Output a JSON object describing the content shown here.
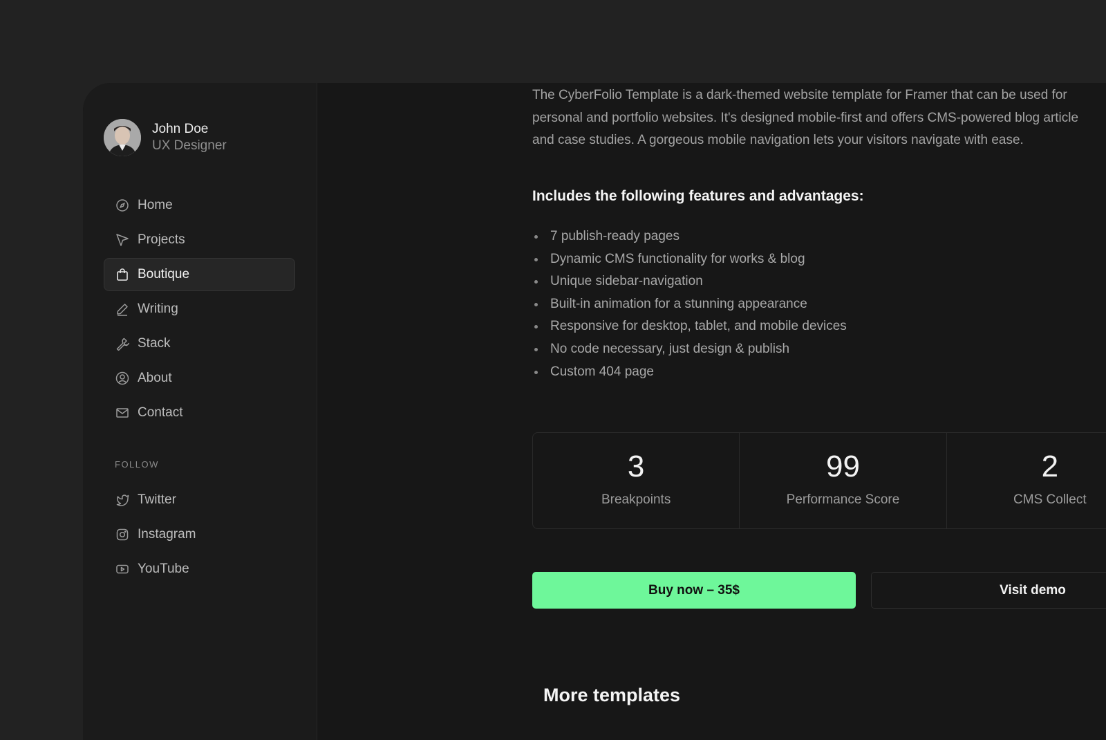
{
  "profile": {
    "name": "John Doe",
    "role": "UX Designer"
  },
  "nav": {
    "items": [
      {
        "label": "Home",
        "icon": "compass-icon",
        "active": false
      },
      {
        "label": "Projects",
        "icon": "send-icon",
        "active": false
      },
      {
        "label": "Boutique",
        "icon": "shopping-bag-icon",
        "active": true
      },
      {
        "label": "Writing",
        "icon": "pen-icon",
        "active": false
      },
      {
        "label": "Stack",
        "icon": "wrench-icon",
        "active": false
      },
      {
        "label": "About",
        "icon": "user-circle-icon",
        "active": false
      },
      {
        "label": "Contact",
        "icon": "mail-icon",
        "active": false
      }
    ]
  },
  "follow": {
    "heading": "FOLLOW",
    "items": [
      {
        "label": "Twitter",
        "icon": "twitter-icon"
      },
      {
        "label": "Instagram",
        "icon": "instagram-icon"
      },
      {
        "label": "YouTube",
        "icon": "youtube-icon"
      }
    ]
  },
  "content": {
    "intro_lines": [
      "The CyberFolio Template is a dark-themed website template for Framer that can be used for",
      "personal and portfolio websites. It's designed mobile-first and offers CMS-powered blog article",
      "and case studies. A gorgeous mobile navigation lets your visitors navigate with ease."
    ],
    "features_heading": "Includes the following features and advantages:",
    "features": [
      "7 publish-ready pages",
      "Dynamic CMS functionality for works & blog",
      "Unique sidebar-navigation",
      "Built-in animation for a stunning appearance",
      "Responsive for desktop, tablet, and mobile devices",
      "No code necessary, just design & publish",
      "Custom 404 page"
    ],
    "stats": [
      {
        "value": "3",
        "label": "Breakpoints"
      },
      {
        "value": "99",
        "label": "Performance Score"
      },
      {
        "value": "2",
        "label": "CMS Collect"
      }
    ],
    "buy_label": "Buy now – 35$",
    "demo_label": "Visit demo",
    "more_heading": "More templates"
  },
  "colors": {
    "accent": "#6ef79a",
    "background": "#171717",
    "sidebar": "#1b1b1b"
  }
}
